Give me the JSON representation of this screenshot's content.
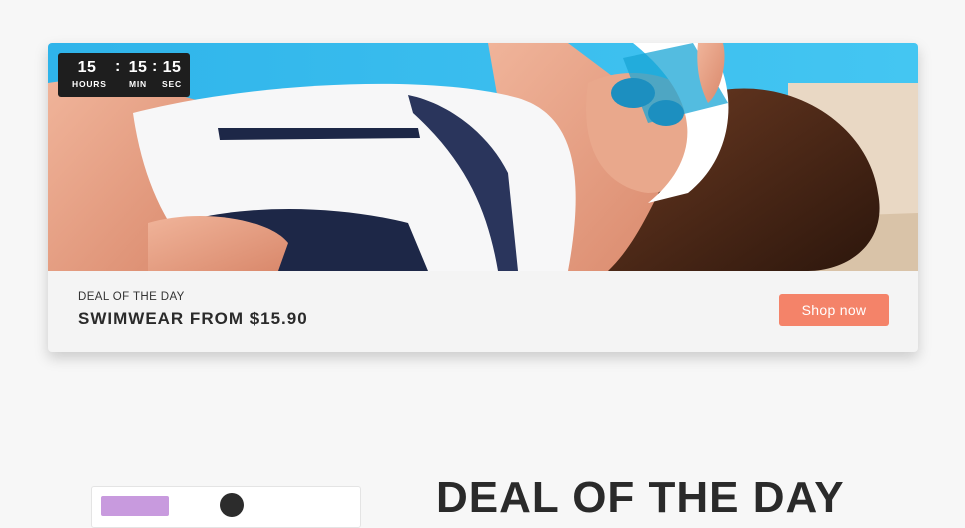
{
  "deal_banner": {
    "countdown": {
      "hours": "15",
      "minutes": "15",
      "seconds": "15",
      "separator": ":",
      "hours_label": "HOURS",
      "minutes_label": "MIN",
      "seconds_label": "SEC"
    },
    "eyebrow": "DEAL OF THE DAY",
    "headline": "SWIMWEAR FROM $15.90",
    "cta_label": "Shop now",
    "cta_color": "#f48369"
  },
  "next_section": {
    "title": "DEAL OF THE DAY",
    "badge_color": "#c89ade"
  }
}
